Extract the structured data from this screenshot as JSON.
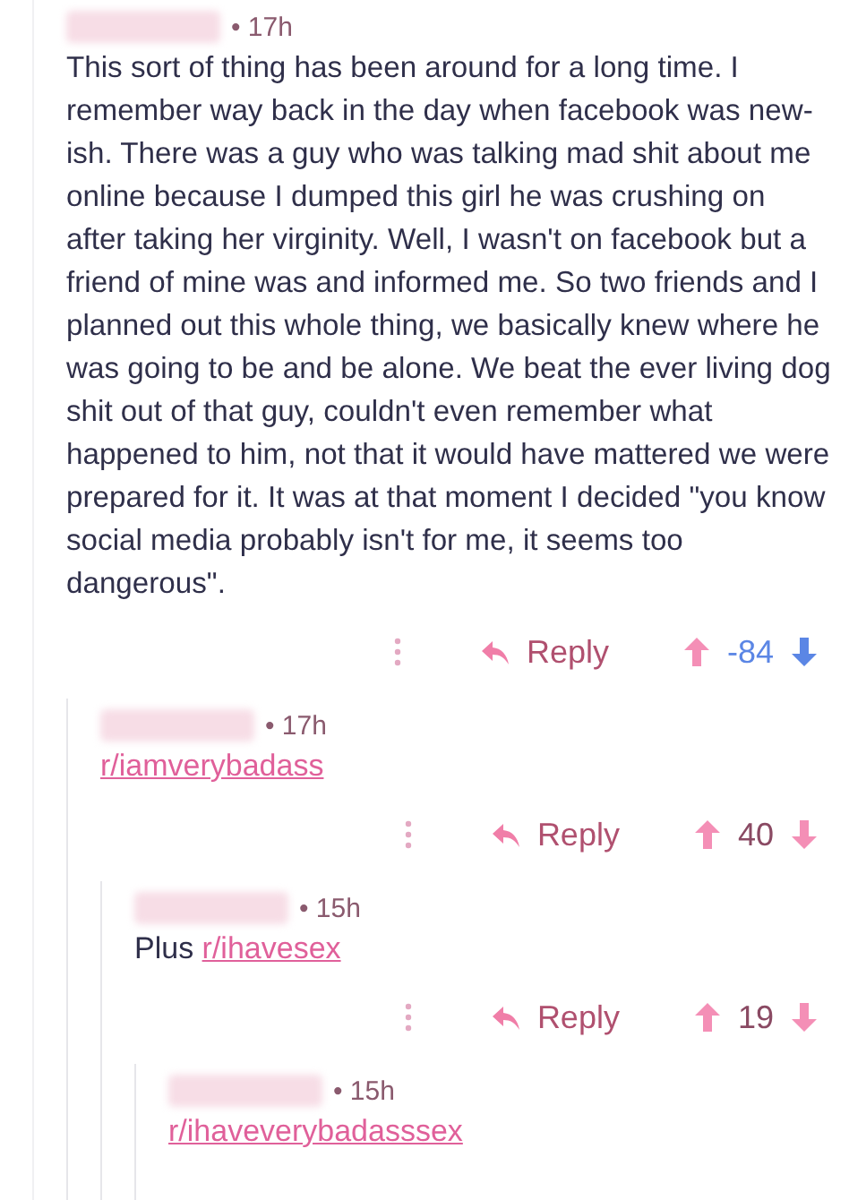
{
  "comments": [
    {
      "time": "• 17h",
      "body": [
        {
          "kind": "text",
          "text": "This sort of thing has been around for a long time. I remember way back in the day when facebook was new-ish. There was a guy who was talking mad shit about me online because I dumped this girl he was crushing on after taking her virginity. Well, I wasn't on facebook but a friend of mine was and informed me. So two friends and I planned out this whole thing, we basically knew where he was going to be and be alone. We beat the ever living dog shit out of that guy, couldn't even remember what happened to him, not that it would have mattered we were prepared for it. It was at that moment I decided \"you know social media probably isn't for me, it seems too dangerous\"."
        }
      ],
      "actions": {
        "reply": "Reply",
        "score": "-84",
        "downvoted": true
      },
      "children": [
        {
          "time": "• 17h",
          "body": [
            {
              "kind": "link",
              "text": "r/iamverybadass"
            }
          ],
          "actions": {
            "reply": "Reply",
            "score": "40",
            "downvoted": false
          },
          "children": [
            {
              "time": "• 15h",
              "body": [
                {
                  "kind": "text",
                  "text": "Plus "
                },
                {
                  "kind": "link",
                  "text": "r/ihavesex"
                }
              ],
              "actions": {
                "reply": "Reply",
                "score": "19",
                "downvoted": false
              },
              "children": [
                {
                  "time": "• 15h",
                  "body": [
                    {
                      "kind": "link",
                      "text": "r/ihaveverybadasssex"
                    }
                  ]
                }
              ]
            }
          ]
        }
      ]
    }
  ]
}
